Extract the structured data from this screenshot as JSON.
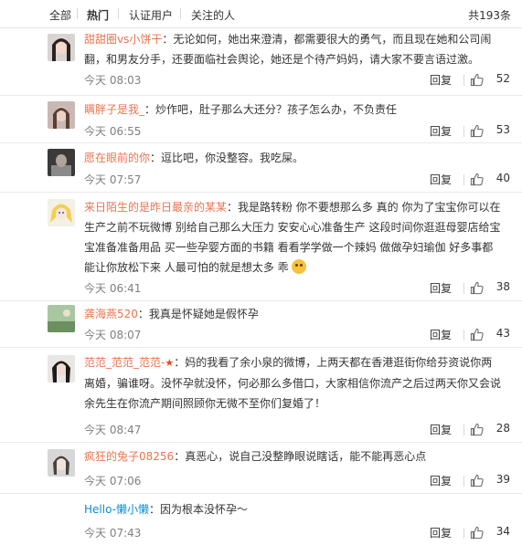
{
  "filters": [
    "全部",
    "热门",
    "认证用户",
    "关注的人"
  ],
  "active_filter": "热门",
  "total_count": "共193条",
  "reply_label": "回复",
  "comments": [
    {
      "user": "甜甜圈vs小饼干",
      "text": "无论如何，她出来澄清，都需要很大的勇气，而且现在她和公司闹翻，和男友分手，还要面临社会舆论，她还是个待产妈妈，请大家不要言语过激。",
      "time": "今天 08:03",
      "likes": "52"
    },
    {
      "user": "瞒胖子是我_",
      "text": "炒作吧，肚子那么大还分？孩子怎么办，不负责任",
      "time": "今天 06:55",
      "likes": "53"
    },
    {
      "user": "愿在眼前的你",
      "text": "逗比吧，你没整容。我吃屎。",
      "time": "今天 07:57",
      "likes": "40"
    },
    {
      "user": "来日陌生的是昨日最亲的某某",
      "text": "我是路转粉 你不要想那么多 真的 你为了宝宝你可以在生产之前不玩微博 别给自己那么大压力 安安心心准备生产 这段时间你逛逛母婴店给宝宝准备准备用品 买一些孕婴方面的书籍 看看学学做一个辣妈 做做孕妇瑜伽 好多事都能让你放松下来 人最可怕的就是想太多 乖",
      "time": "今天 06:41",
      "likes": "38"
    },
    {
      "user": "龚海燕520",
      "text": "我真是怀疑她是假怀孕",
      "time": "今天 08:07",
      "likes": "43"
    },
    {
      "user": "范范_范范_范范-",
      "text": "妈的我看了余小泉的微博，上两天都在香港逛街你给芬资说你两离婚，骗谁呀。没怀孕就没怀，何必那么多借口，大家相信你流产之后过两天你又会说余先生在你流产期间照顾你无微不至你们复婚了！",
      "time": "今天 08:47",
      "likes": "28"
    },
    {
      "user": "疯狂的兔子08256",
      "text": "真恶心，说自己没整睁眼说瞎话，能不能再恶心点",
      "time": "今天 07:06",
      "likes": "39"
    },
    {
      "user": "Hello-懒小懒",
      "text": "因为根本没怀孕～",
      "time": "今天 07:43",
      "likes": "34"
    }
  ],
  "colors": {
    "username": "#eb7350",
    "username_alt": "#0a8cd2",
    "meta": "#808080",
    "divider": "#eaeaea"
  },
  "icons": {
    "like": "thumbs-up-icon",
    "star": "star-icon",
    "emoji": "smile-emoji-icon"
  }
}
